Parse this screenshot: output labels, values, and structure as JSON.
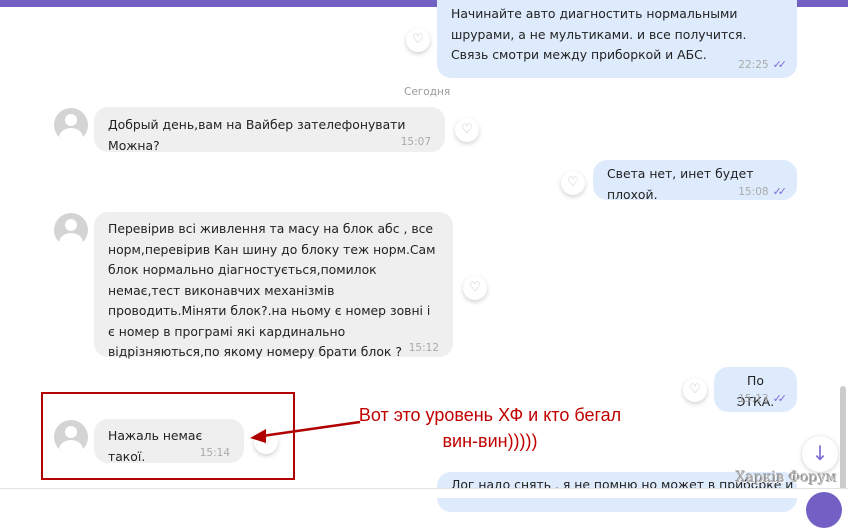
{
  "date_separator": "Сегодня",
  "messages": [
    {
      "dir": "out",
      "text": "Начинайте авто диагностить нормальными шрурами, а не мультиками. и все получится. Связь смотри между приборкой и АБС.",
      "time": "22:25"
    },
    {
      "dir": "in",
      "text": "Добрый день,вам на Вайбер зателефонувати Можна?",
      "time": "15:07"
    },
    {
      "dir": "out",
      "text": "Света нет, инет будет плохой.",
      "time": "15:08"
    },
    {
      "dir": "in",
      "text": "Перевірив всі живлення та масу на блок абс , все норм,перевірив Кан шину до блоку теж норм.Сам блок нормально діагностується,помилок немає,тест виконавчих механізмів проводить.Міняти блок?.на ньому є номер зовні і є номер в програмі які кардинально відрізняються,по якому номеру брати блок ?",
      "time": "15:12"
    },
    {
      "dir": "out",
      "text": "По ЭТКА.",
      "time": "15:13"
    },
    {
      "dir": "in",
      "text": "Нажаль немає такої.",
      "time": "15:14"
    },
    {
      "dir": "out",
      "text": "Лог надо снять , я не помню но может в приборке и т"
    }
  ],
  "ticks": "✓✓",
  "annotation": "Вот это уровень ХФ и кто бегал вин-вин)))))",
  "watermark": "Харків Форум",
  "colors": {
    "accent": "#7360c4",
    "annotation": "#c00000"
  }
}
